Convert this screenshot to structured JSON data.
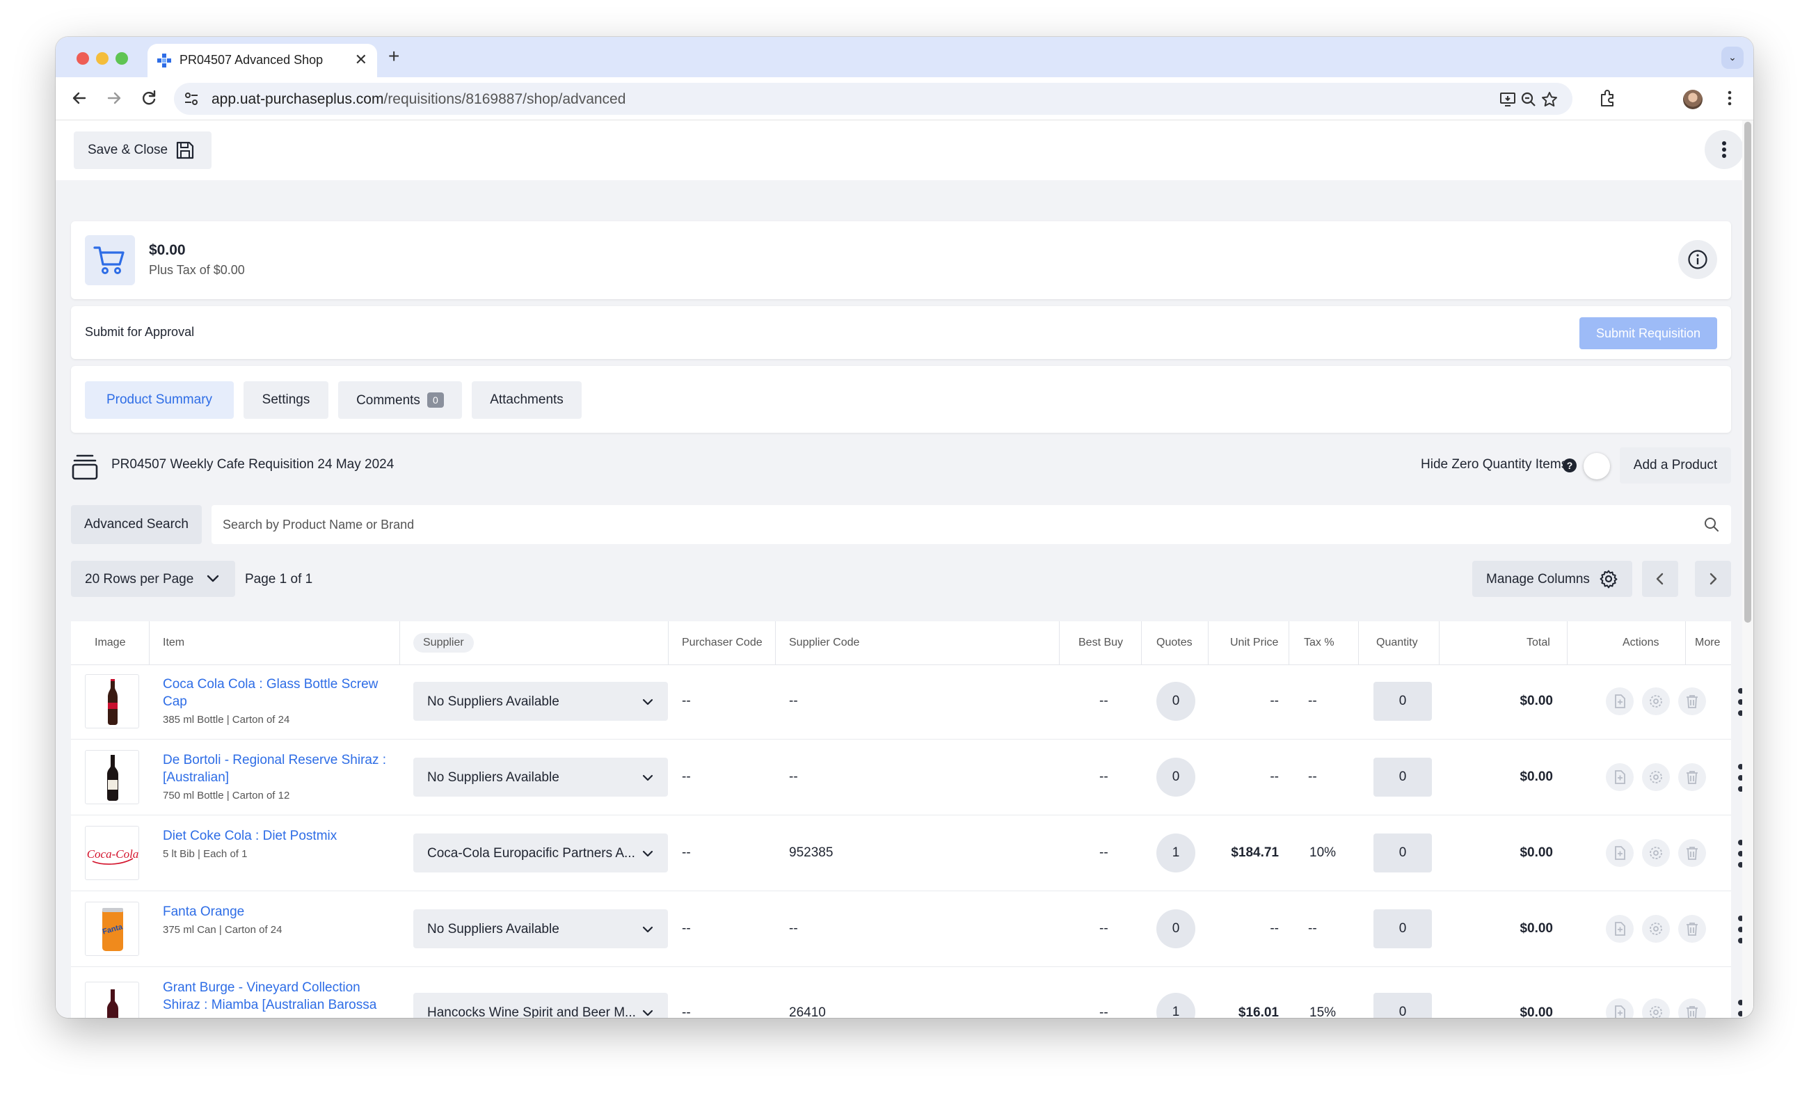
{
  "browser": {
    "tab_title": "PR04507 Advanced Shop",
    "tab_close": "✕",
    "new_tab": "+",
    "url_host": "app.uat-purchaseplus.com",
    "url_path": "/requisitions/8169887/shop/advanced"
  },
  "toolbar": {
    "save_close_label": "Save & Close"
  },
  "summary": {
    "total": "$0.00",
    "tax": "Plus Tax of $0.00"
  },
  "approval": {
    "label": "Submit for Approval",
    "submit_label": "Submit Requisition"
  },
  "tabs": [
    {
      "label": "Product Summary",
      "active": true
    },
    {
      "label": "Settings"
    },
    {
      "label": "Comments",
      "badge": "0"
    },
    {
      "label": "Attachments"
    }
  ],
  "requisition": {
    "title": "PR04507 Weekly Cafe Requisition 24 May 2024",
    "hide_zero_label": "Hide Zero Quantity Items",
    "help": "?",
    "add_product": "Add a Product"
  },
  "search": {
    "advanced_label": "Advanced Search",
    "placeholder": "Search by Product Name or Brand"
  },
  "pager": {
    "rows_per_page": "20 Rows per Page",
    "page_info": "Page 1 of 1",
    "manage_columns": "Manage Columns"
  },
  "table": {
    "headers": {
      "image": "Image",
      "item": "Item",
      "supplier": "Supplier",
      "purchaser_code": "Purchaser Code",
      "supplier_code": "Supplier Code",
      "best_buy": "Best Buy",
      "quotes": "Quotes",
      "unit_price": "Unit Price",
      "tax": "Tax %",
      "quantity": "Quantity",
      "total": "Total",
      "actions": "Actions",
      "more": "More"
    },
    "rows": [
      {
        "name1": "Coca Cola Cola : Glass Bottle Screw",
        "name2": "Cap",
        "sub": "385 ml Bottle | Carton of 24",
        "supplier": "No Suppliers Available",
        "purchaser_code": "--",
        "supplier_code": "--",
        "best_buy": "--",
        "quotes": "0",
        "unit_price": "--",
        "tax": "--",
        "quantity": "0",
        "total": "$0.00",
        "image_icon": "cola-bottle-image"
      },
      {
        "name1": "De Bortoli - Regional Reserve Shiraz :",
        "name2": "[Australian]",
        "sub": "750 ml Bottle | Carton of 12",
        "supplier": "No Suppliers Available",
        "purchaser_code": "--",
        "supplier_code": "--",
        "best_buy": "--",
        "quotes": "0",
        "unit_price": "--",
        "tax": "--",
        "quantity": "0",
        "total": "$0.00",
        "image_icon": "wine-bottle-image"
      },
      {
        "name1": "Diet Coke Cola : Diet Postmix",
        "name2": "",
        "sub": "5 lt Bib | Each of 1",
        "supplier": "Coca-Cola Europacific Partners A...",
        "purchaser_code": "--",
        "supplier_code": "952385",
        "best_buy": "--",
        "quotes": "1",
        "unit_price": "$184.71",
        "tax": "10%",
        "quantity": "0",
        "total": "$0.00",
        "image_icon": "coca-cola-logo-image",
        "logo_text": "Coca-Cola"
      },
      {
        "name1": "Fanta Orange",
        "name2": "",
        "sub": "375 ml Can | Carton of 24",
        "supplier": "No Suppliers Available",
        "purchaser_code": "--",
        "supplier_code": "--",
        "best_buy": "--",
        "quotes": "0",
        "unit_price": "--",
        "tax": "--",
        "quantity": "0",
        "total": "$0.00",
        "image_icon": "fanta-can-image",
        "logo_text": "Fanta"
      },
      {
        "name1": "Grant Burge - Vineyard Collection",
        "name2": "Shiraz : Miamba [Australian Barossa",
        "sub": "",
        "supplier": "Hancocks Wine Spirit and Beer M...",
        "purchaser_code": "--",
        "supplier_code": "26410",
        "best_buy": "--",
        "quotes": "1",
        "unit_price": "$16.01",
        "tax": "15%",
        "quantity": "0",
        "total": "$0.00",
        "image_icon": "wine-bottle-image"
      }
    ]
  },
  "colors": {
    "accent": "#2e6de6",
    "submit_disabled": "#9dbbf7",
    "page_bg": "#f2f3f6",
    "tab_strip": "#dde6fb"
  }
}
